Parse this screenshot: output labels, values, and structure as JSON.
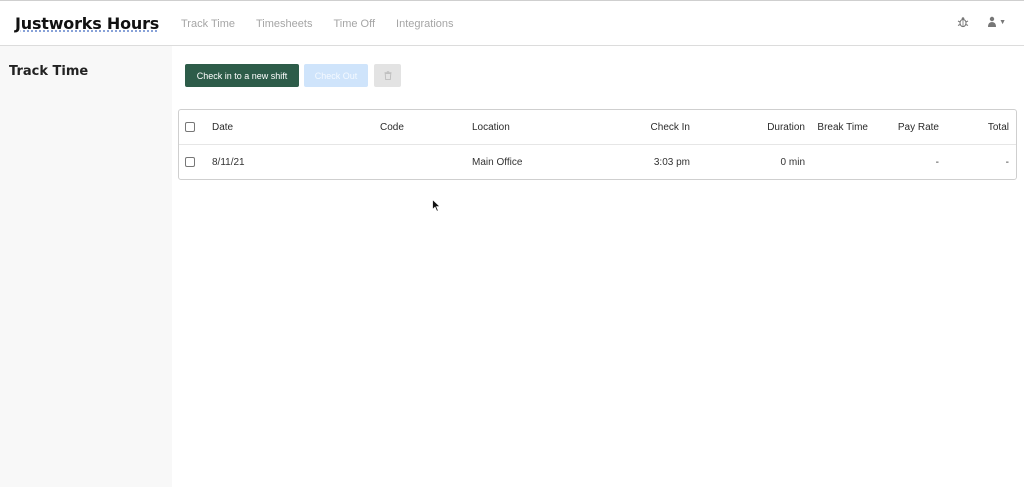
{
  "app": {
    "brand": "Justworks Hours"
  },
  "nav": {
    "items": [
      {
        "label": "Track Time"
      },
      {
        "label": "Timesheets"
      },
      {
        "label": "Time Off"
      },
      {
        "label": "Integrations"
      }
    ]
  },
  "header_icons": {
    "left": "bug-icon",
    "right": "user-menu-icon"
  },
  "page": {
    "title": "Track Time"
  },
  "toolbar": {
    "checkin_label": "Check in to a new shift",
    "checkout_label": "Check Out",
    "delete_icon": "trash-icon"
  },
  "table": {
    "columns": [
      "Date",
      "Code",
      "Location",
      "Check In",
      "Duration",
      "Break Time",
      "Pay Rate",
      "Total"
    ],
    "rows": [
      {
        "date": "8/11/21",
        "code": "",
        "location": "Main Office",
        "check_in": "3:03 pm",
        "duration": "0 min",
        "break_time": "",
        "pay_rate": "-",
        "total": "-"
      }
    ]
  },
  "colors": {
    "primary": "#2d5c49",
    "disabled_button": "#cfe4fb",
    "sidebar_bg": "#f8f8f8"
  }
}
